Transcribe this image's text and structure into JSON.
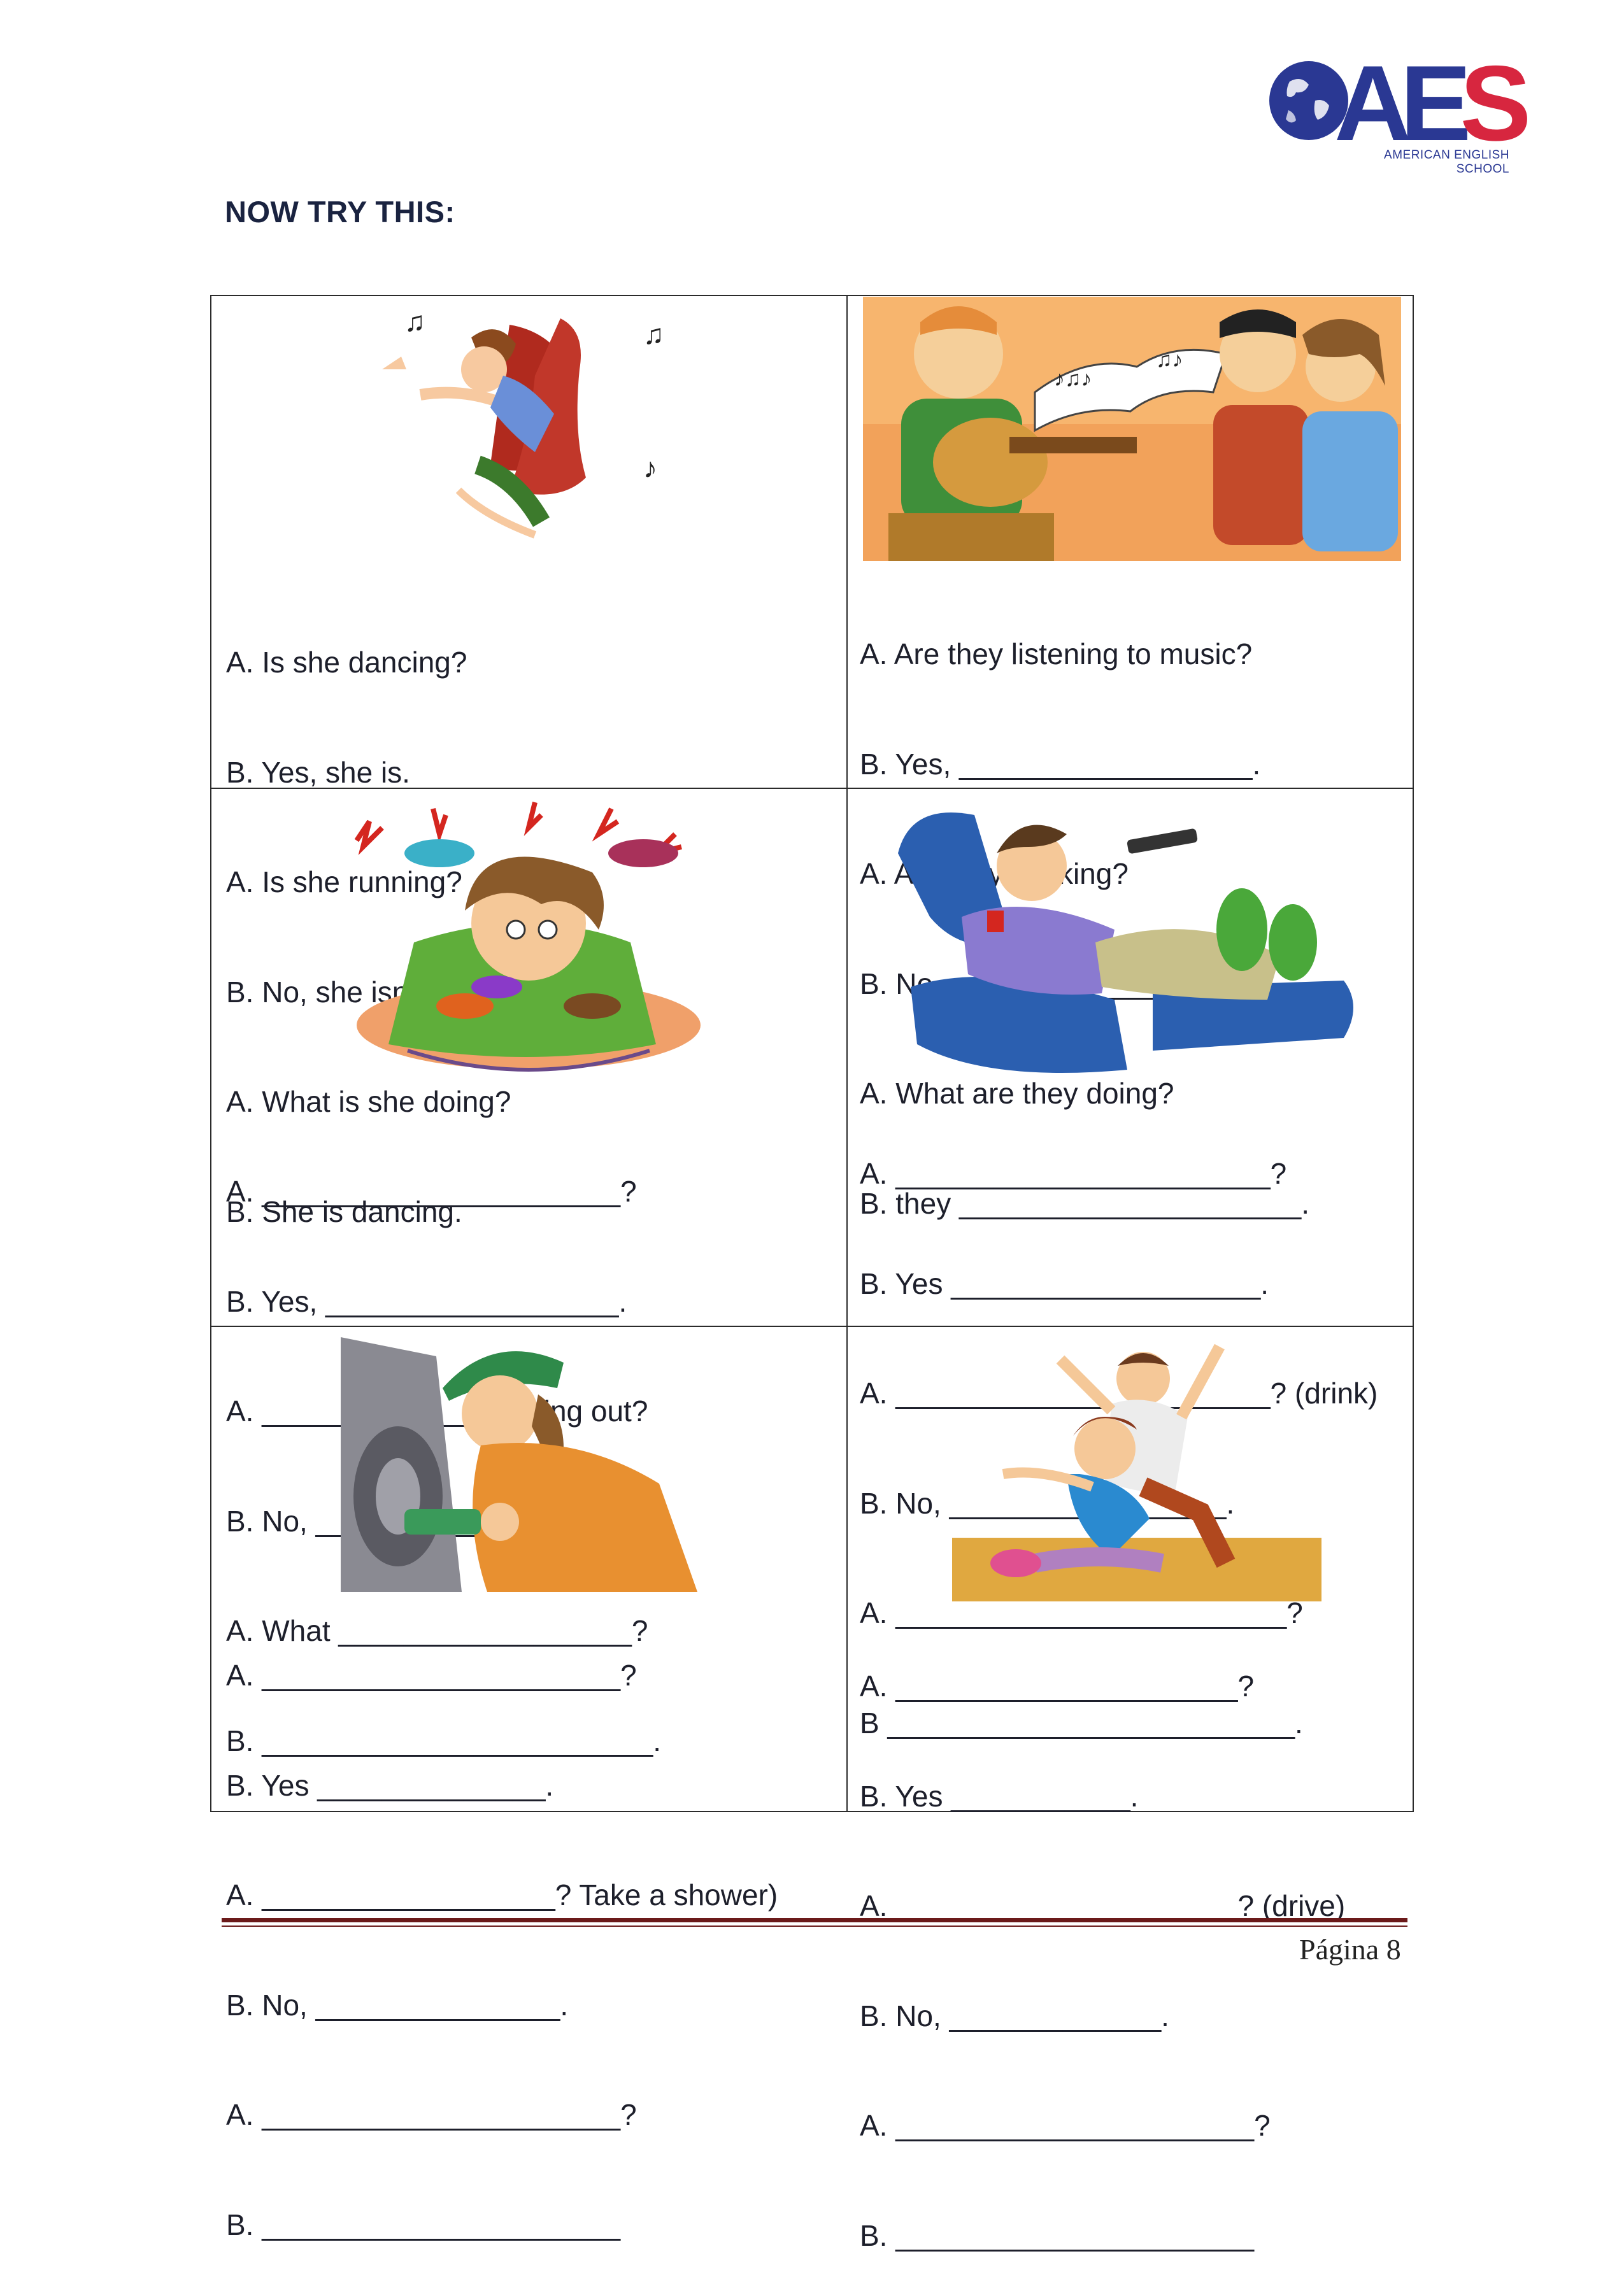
{
  "logo": {
    "brand_ae": "AE",
    "brand_s": "S",
    "line1": "AMERICAN ENGLISH",
    "line2": "SCHOOL",
    "colors": {
      "navy": "#2a3893",
      "red": "#d7263f"
    }
  },
  "heading": "NOW TRY THIS:",
  "cells": [
    {
      "image": "couple-dancing-illustration",
      "lines": [
        "A. Is she dancing?",
        "B. Yes, she is.",
        "A. Is she running?",
        "B. No, she isn’t.",
        "A. What is she doing?",
        "B. She is dancing."
      ]
    },
    {
      "image": "man-playing-guitar-people-covering-ears-illustration",
      "lines": [
        "A. Are they listening to music?",
        "B. Yes, __________________.",
        "A. Are they cooking?",
        "B. No, ______________________.",
        "A. What are they doing?",
        "B. they _____________________."
      ]
    },
    {
      "image": "person-with-many-ringing-phones-illustration",
      "lines": [
        "A. ______________________?",
        "B. Yes, __________________.",
        "A. _____________ working out?",
        "B. No, ___________________.",
        "A. What __________________?",
        "B. ________________________."
      ]
    },
    {
      "image": "man-relaxing-in-armchair-with-remote-illustration",
      "lines": [
        "A. _______________________?",
        "B. Yes ___________________.",
        "A. _______________________? (drink)",
        "B. No, _________________.",
        "A. ________________________?",
        "B _________________________."
      ]
    },
    {
      "image": "mechanic-with-drill-at-car-illustration",
      "lines": [
        "A. ______________________?",
        "B. Yes ______________.",
        "A. __________________? Take a shower)",
        "B. No, _______________.",
        "A. ______________________?",
        "B. ______________________"
      ]
    },
    {
      "image": "couple-exercising-stretching-illustration",
      "lines": [
        "A. _____________________?",
        "B. Yes ___________.",
        "A. _____________________? (drive)",
        "B. No, _____________.",
        "A. ______________________?",
        "B. ______________________"
      ]
    }
  ],
  "footer": {
    "label": "Página",
    "page": "8"
  }
}
